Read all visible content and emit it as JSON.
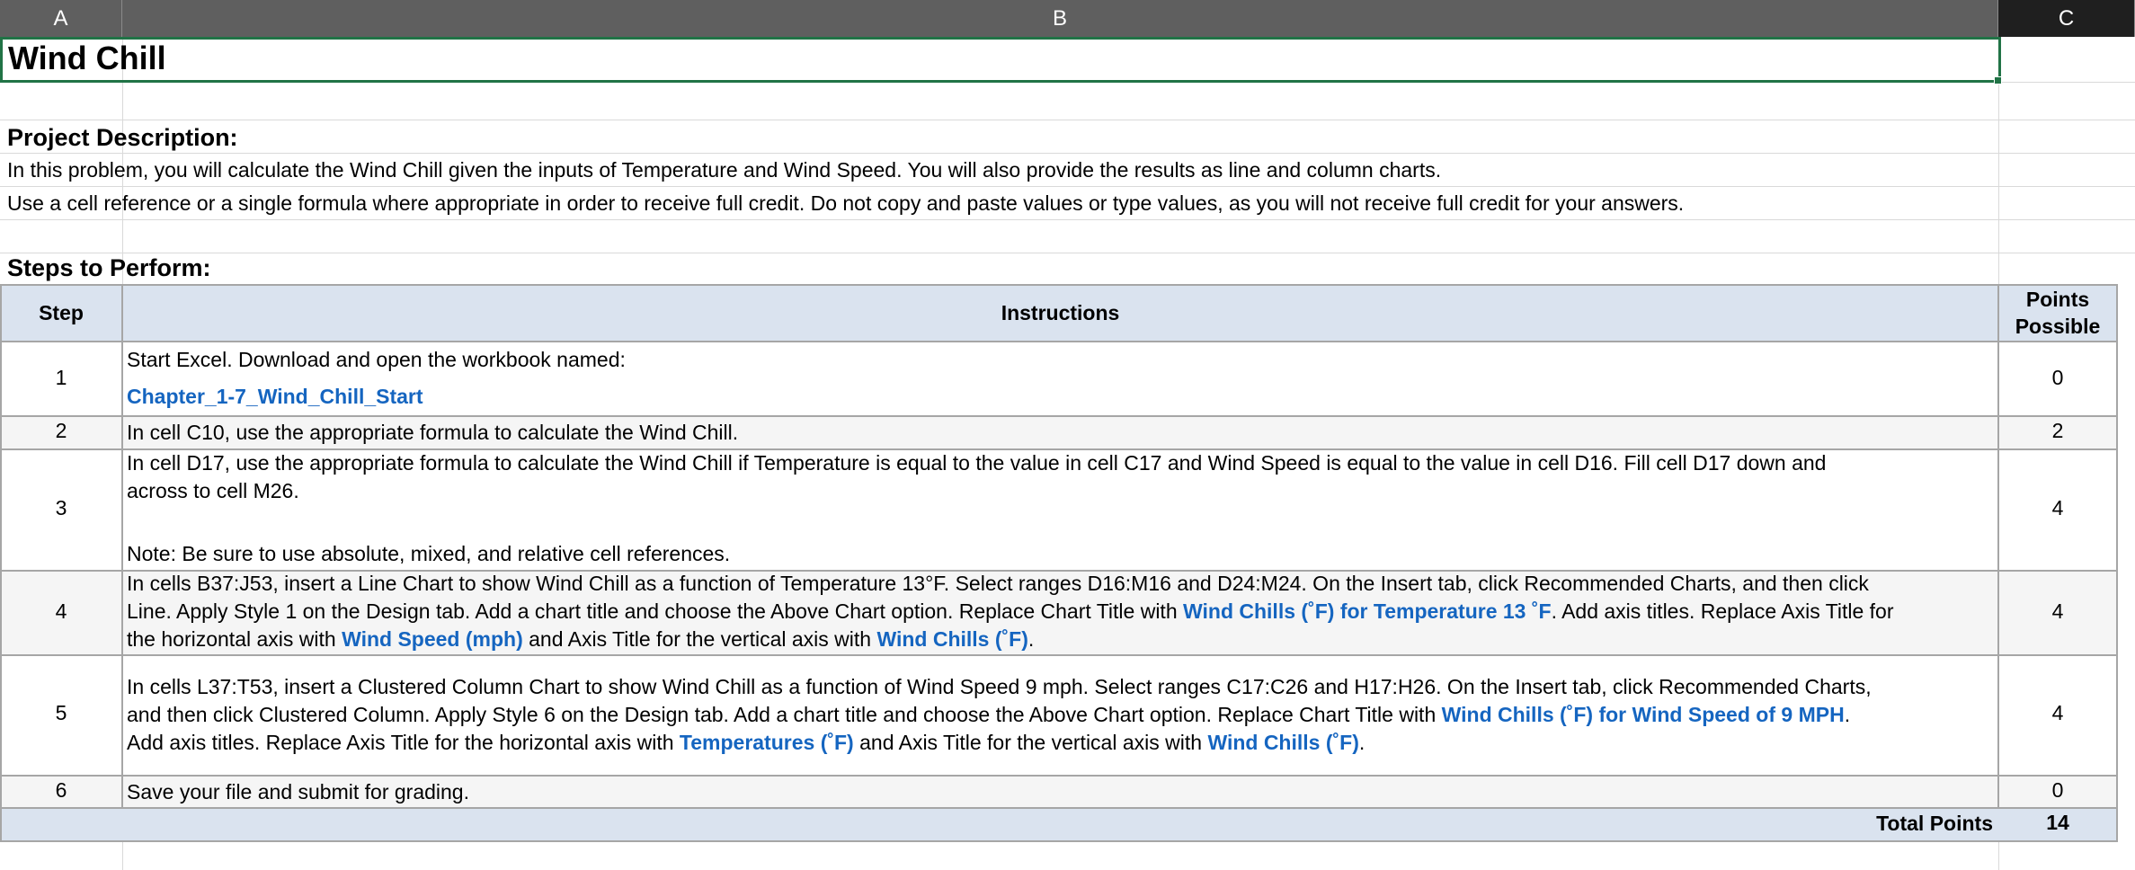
{
  "columns": [
    "A",
    "B",
    "C"
  ],
  "title": "Wind Chill",
  "project_description_heading": "Project Description:",
  "description_lines": [
    "In this problem, you will calculate the Wind Chill given the inputs of Temperature and Wind Speed. You will also provide the results as line and column charts.",
    "Use a cell reference or a single formula where appropriate in order to receive full credit. Do not copy and paste values or type values, as you will not receive full credit for your answers."
  ],
  "steps_heading": "Steps to Perform:",
  "table_headers": {
    "step": "Step",
    "instructions": "Instructions",
    "points_line1": "Points",
    "points_line2": "Possible"
  },
  "steps": [
    {
      "step": "1",
      "text_a": "Start Excel. Download and open the workbook named:",
      "link_a": "Chapter_1-7_Wind_Chill_Start",
      "points": "0"
    },
    {
      "step": "2",
      "text_a": "In cell C10, use the appropriate formula to calculate the Wind Chill.",
      "points": "2"
    },
    {
      "step": "3",
      "line1": "In cell D17, use the appropriate formula to calculate the Wind Chill if Temperature is equal to the value in cell C17 and Wind Speed is equal to the value in cell D16. Fill cell D17 down and",
      "line2": "across to cell M26.",
      "note": "Note: Be sure to use absolute, mixed, and relative cell references.",
      "points": "4"
    },
    {
      "step": "4",
      "line1": "In cells B37:J53, insert a Line Chart to show Wind Chill as a function of Temperature 13°F. Select ranges D16:M16 and D24:M24. On the Insert tab, click Recommended Charts, and then click",
      "line2_a": "Line. Apply Style 1 on the Design tab. Add a chart title and choose the Above Chart option. Replace Chart Title with ",
      "line2_link": "Wind Chills (˚F) for Temperature 13 ˚F",
      "line2_b": ". Add axis titles. Replace Axis Title for",
      "line3_a": "the horizontal axis with ",
      "line3_link1": "Wind Speed (mph)",
      "line3_b": " and Axis Title for the vertical axis with ",
      "line3_link2": "Wind Chills (˚F)",
      "line3_c": ".",
      "points": "4"
    },
    {
      "step": "5",
      "line1": "In cells L37:T53, insert a Clustered Column Chart to show Wind Chill as a function of Wind Speed 9 mph. Select ranges C17:C26 and H17:H26. On the Insert tab, click Recommended Charts,",
      "line2_a": "and then click Clustered Column. Apply Style 6 on the Design tab. Add a chart title and choose the Above Chart option. Replace Chart Title with ",
      "line2_link": "Wind Chills (˚F) for Wind Speed of 9 MPH",
      "line2_b": ".",
      "line3_a": "Add axis titles. Replace Axis Title for the horizontal axis with ",
      "line3_link1": "Temperatures (˚F)",
      "line3_b": " and Axis Title for the vertical axis with ",
      "line3_link2": "Wind Chills (˚F)",
      "line3_c": ".",
      "points": "4"
    },
    {
      "step": "6",
      "text_a": "Save your file and submit for grading.",
      "points": "0"
    }
  ],
  "total_label": "Total Points",
  "total_value": "14",
  "colors": {
    "header_fill": "#dae3ef",
    "link": "#1565c0",
    "selection": "#217346",
    "column_header": "#5f5f5f"
  }
}
